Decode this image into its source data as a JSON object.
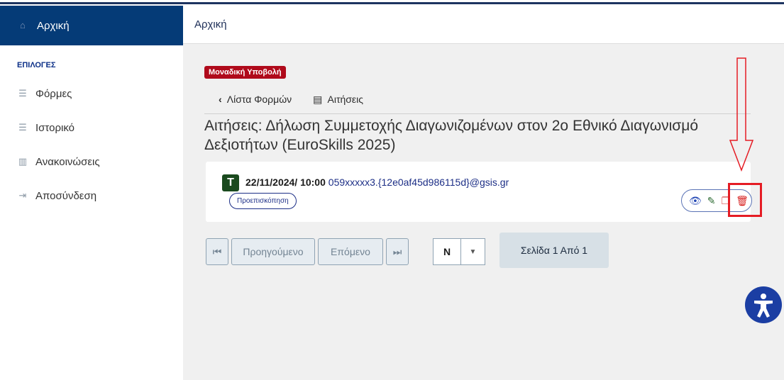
{
  "sidebar": {
    "home_label": "Αρχική",
    "section_label": "ΕΠΙΛΟΓΕΣ",
    "items": [
      {
        "label": "Φόρμες",
        "icon": "list-icon"
      },
      {
        "label": "Ιστορικό",
        "icon": "list-icon"
      },
      {
        "label": "Ανακοινώσεις",
        "icon": "book-icon"
      },
      {
        "label": "Αποσύνδεση",
        "icon": "logout-icon"
      }
    ]
  },
  "header": {
    "breadcrumb": "Αρχική"
  },
  "main": {
    "badge": "Μοναδική Υποβολή",
    "subnav": {
      "forms_list": "Λίστα Φορμών",
      "requests": "Αιτήσεις"
    },
    "title": "Αιτήσεις: Δήλωση Συμμετοχής Διαγωνιζομένων στον 2ο Εθνικό Διαγωνισμό Δεξιοτήτων (EuroSkills 2025)",
    "entry": {
      "badge_letter": "T",
      "date": "22/11/2024/ 10:00",
      "email": "059xxxxx3.{12e0af45d986115d}@gsis.gr",
      "preview_label": "Προεπισκόπηση"
    },
    "pager": {
      "first": "⏮",
      "prev": "Προηγούμενο",
      "next": "Επόμενο",
      "last": "⏭",
      "page_size": "N",
      "page_info": "Σελίδα 1 Από 1"
    }
  },
  "colors": {
    "primary": "#053b77",
    "danger": "#b00a1b",
    "highlight": "#e51c24"
  }
}
